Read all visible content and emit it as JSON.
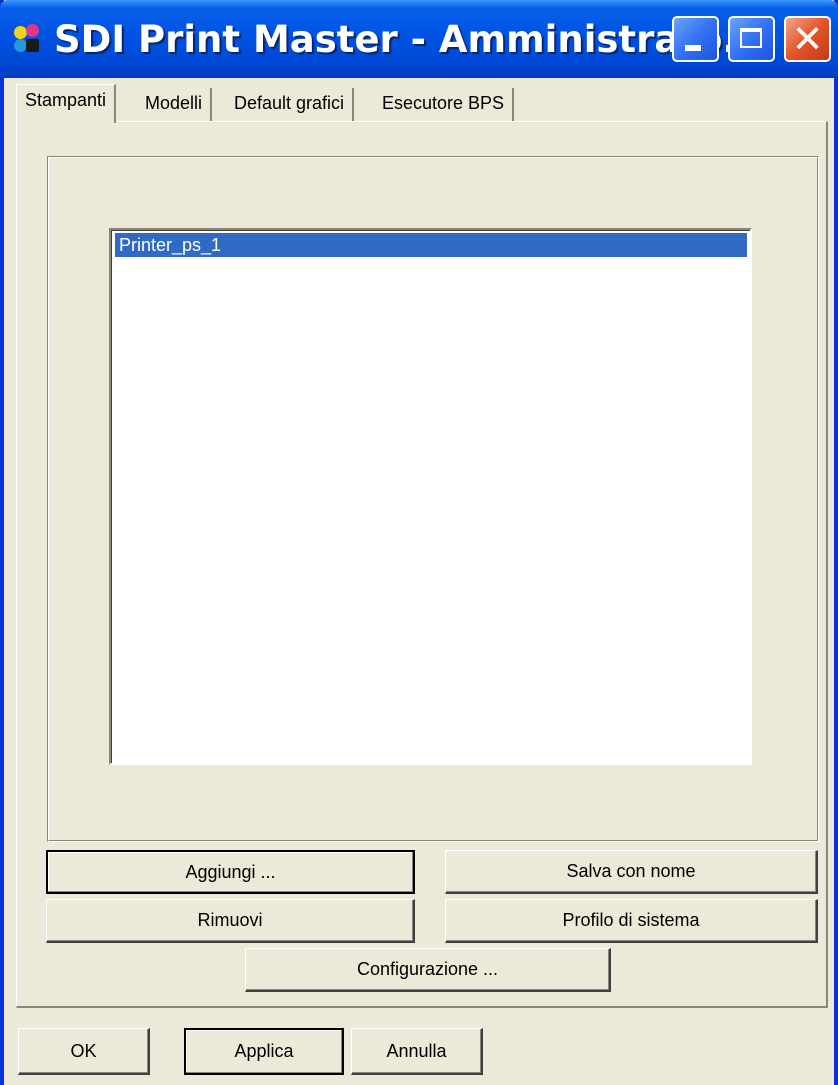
{
  "window": {
    "title": "SDI Print Master - Amministrato...",
    "icon": "sdi-logo-icon",
    "controls": {
      "minimize": "minimize-icon",
      "maximize": "maximize-icon",
      "close": "close-icon",
      "close_glyph": "✕"
    }
  },
  "tabs": [
    {
      "label": "Stampanti",
      "active": true
    },
    {
      "label": "Modelli",
      "active": false
    },
    {
      "label": "Default grafici",
      "active": false
    },
    {
      "label": "Esecutore BPS",
      "active": false
    }
  ],
  "printer_list": {
    "items": [
      {
        "label": "Printer_ps_1",
        "selected": true
      }
    ]
  },
  "panel_buttons": {
    "add": "Aggiungi ...",
    "save_as": "Salva con nome",
    "remove": "Rimuovi",
    "system_profile": "Profilo di sistema",
    "configuration": "Configurazione ..."
  },
  "dialog_buttons": {
    "ok": "OK",
    "apply": "Applica",
    "cancel": "Annulla"
  },
  "colors": {
    "titlebar": "#0055e5",
    "face": "#ece9d8",
    "selection": "#316ac5",
    "close_button": "#e3542a"
  }
}
